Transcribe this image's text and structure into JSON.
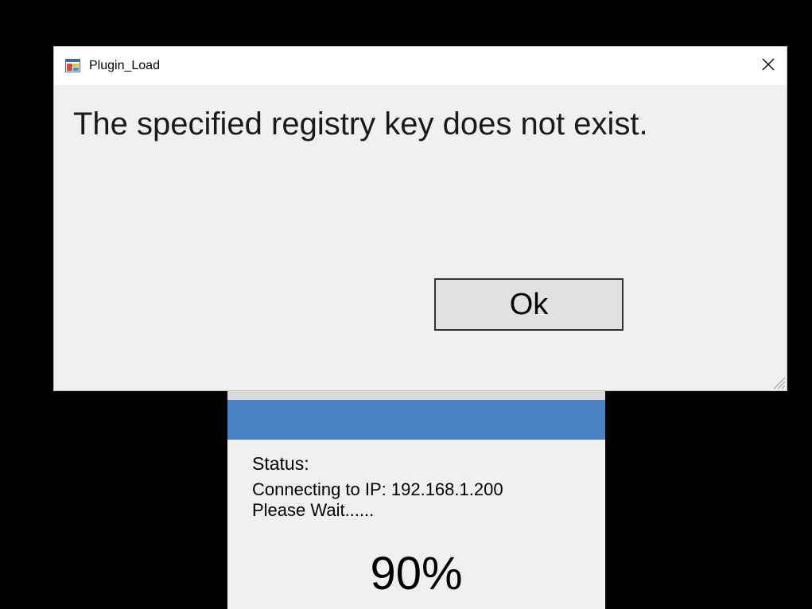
{
  "dialog": {
    "title": "Plugin_Load",
    "app_icon": "application-window-icon",
    "close_icon": "close-icon",
    "message": "The specified registry key does not exist.",
    "ok_label": "Ok",
    "resize_grip_icon": "resize-grip-icon"
  },
  "status_window": {
    "heading": "Status:",
    "line1": "Connecting to IP: 192.168.1.200",
    "line2": "Please Wait......",
    "percent": "90%",
    "header_color": "#4682c4"
  },
  "colors": {
    "desktop_background": "#000000",
    "dialog_background": "#f0f0f0",
    "titlebar_background": "#ffffff"
  }
}
